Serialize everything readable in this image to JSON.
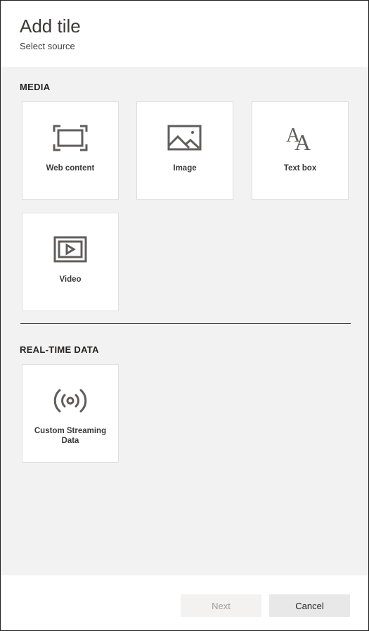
{
  "dialog": {
    "title": "Add tile",
    "subtitle": "Select source"
  },
  "sections": {
    "media": {
      "heading": "MEDIA",
      "tiles": [
        {
          "label": "Web content",
          "icon": "web-content-icon"
        },
        {
          "label": "Image",
          "icon": "image-icon"
        },
        {
          "label": "Text box",
          "icon": "text-box-icon"
        },
        {
          "label": "Video",
          "icon": "video-icon"
        }
      ]
    },
    "realtime": {
      "heading": "REAL-TIME DATA",
      "tiles": [
        {
          "label": "Custom Streaming Data",
          "icon": "streaming-data-icon"
        }
      ]
    }
  },
  "footer": {
    "next_label": "Next",
    "cancel_label": "Cancel"
  },
  "colors": {
    "panel_background": "#f2f2f2",
    "tile_background": "#ffffff",
    "icon_stroke": "#605e5c",
    "disabled_text": "#a19f9d"
  }
}
